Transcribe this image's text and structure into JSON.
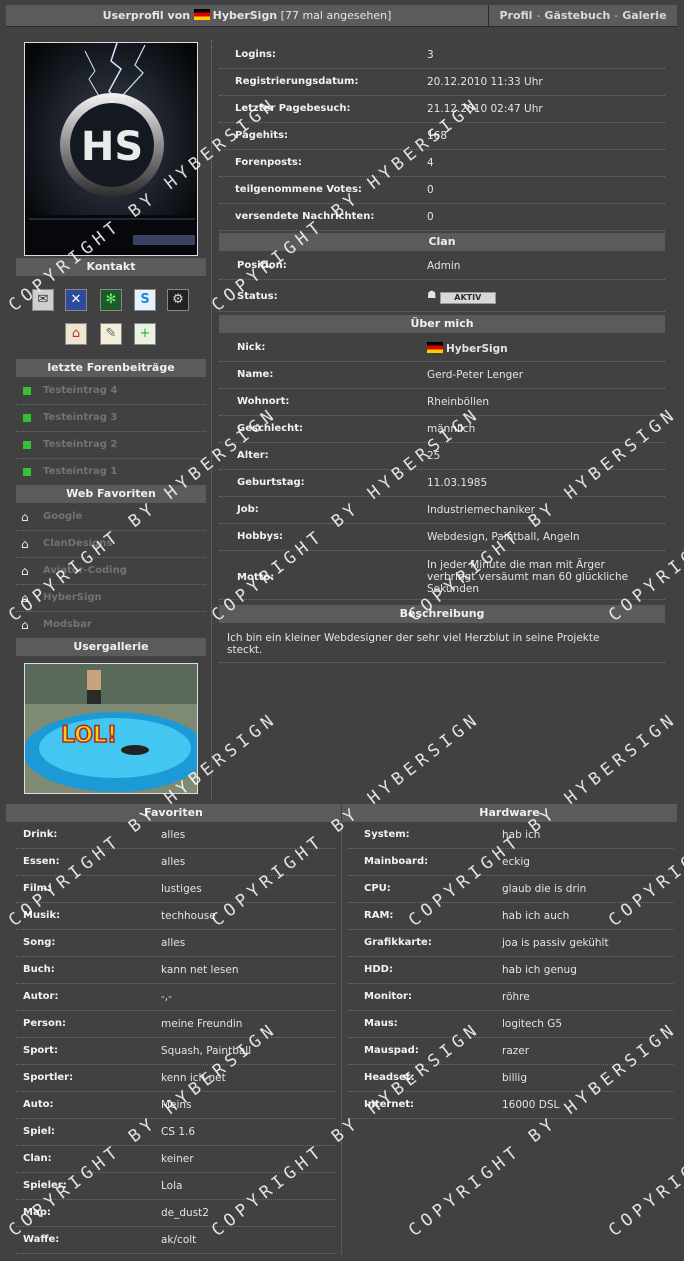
{
  "header": {
    "title_prefix": "Userprofil von",
    "username": "HyberSign",
    "views": "[77 mal angesehen]",
    "links": [
      "Profil",
      "Gästebuch",
      "Galerie"
    ]
  },
  "avatar": {
    "letters": "HS"
  },
  "kontakt": {
    "title": "Kontakt",
    "icons": [
      "mail-icon",
      "xfire-icon",
      "icq-icon",
      "skype-icon",
      "steam-icon",
      "homepage-icon",
      "guestbook-icon",
      "add-friend-icon"
    ]
  },
  "forum": {
    "title": "letzte Forenbeiträge",
    "items": [
      "Testeintrag 4",
      "Testeintrag 3",
      "Testeintrag 2",
      "Testeintrag 1"
    ]
  },
  "favorites_web": {
    "title": "Web Favoriten",
    "items": [
      "Google",
      "ClanDesigns",
      "Aviator-Coding",
      "HyberSign",
      "Modsbar"
    ]
  },
  "gallery": {
    "title": "Usergallerie",
    "caption": "LOL!"
  },
  "stats": [
    {
      "label": "Logins:",
      "value": "3"
    },
    {
      "label": "Registrierungsdatum:",
      "value": "20.12.2010 11:33 Uhr"
    },
    {
      "label": "Letzter Pagebesuch:",
      "value": "21.12.2010 02:47 Uhr"
    },
    {
      "label": "Pagehits:",
      "value": "168"
    },
    {
      "label": "Forenposts:",
      "value": "4"
    },
    {
      "label": "teilgenommene Votes:",
      "value": "0"
    },
    {
      "label": "versendete Nachrichten:",
      "value": "0"
    }
  ],
  "clan": {
    "title": "Clan",
    "position_label": "Position:",
    "position_value": "Admin",
    "status_label": "Status:",
    "status_value": "AKTIV"
  },
  "about": {
    "title": "Über mich",
    "rows": [
      {
        "label": "Nick:",
        "value": "HyberSign"
      },
      {
        "label": "Name:",
        "value": "Gerd-Peter Lenger"
      },
      {
        "label": "Wohnort:",
        "value": "Rheinböllen"
      },
      {
        "label": "Geschlecht:",
        "value": "männlich"
      },
      {
        "label": "Alter:",
        "value": "25"
      },
      {
        "label": "Geburtstag:",
        "value": "11.03.1985"
      },
      {
        "label": "Job:",
        "value": "Industriemechaniker"
      },
      {
        "label": "Hobbys:",
        "value": "Webdesign, Paintball, Angeln"
      }
    ],
    "motto_label": "Motto:",
    "motto_lines": [
      "In jeder Minute die man mit Ärger",
      "verbringt versäumt man 60 glückliche",
      "Sekunden"
    ]
  },
  "description": {
    "title": "Beschreibung",
    "lines": [
      "Ich bin ein kleiner Webdesigner der sehr viel Herzblut in seine Projekte",
      "steckt."
    ]
  },
  "favoriten": {
    "title": "Favoriten",
    "rows": [
      {
        "label": "Drink:",
        "value": "alles"
      },
      {
        "label": "Essen:",
        "value": "alles"
      },
      {
        "label": "Film:",
        "value": "lustiges"
      },
      {
        "label": "Musik:",
        "value": "techhouse"
      },
      {
        "label": "Song:",
        "value": "alles"
      },
      {
        "label": "Buch:",
        "value": "kann net lesen"
      },
      {
        "label": "Autor:",
        "value": "-,-"
      },
      {
        "label": "Person:",
        "value": "meine Freundin"
      },
      {
        "label": "Sport:",
        "value": "Squash, Paintball"
      },
      {
        "label": "Sportler:",
        "value": "kenn ich net"
      },
      {
        "label": "Auto:",
        "value": "Meins"
      },
      {
        "label": "Spiel:",
        "value": "CS 1.6"
      },
      {
        "label": "Clan:",
        "value": "keiner"
      },
      {
        "label": "Spieler:",
        "value": "Lola"
      },
      {
        "label": "Map:",
        "value": "de_dust2"
      },
      {
        "label": "Waffe:",
        "value": "ak/colt"
      }
    ]
  },
  "hardware": {
    "title": "Hardware",
    "rows": [
      {
        "label": "System:",
        "value": "hab ich"
      },
      {
        "label": "Mainboard:",
        "value": "eckig"
      },
      {
        "label": "CPU:",
        "value": "glaub die is drin"
      },
      {
        "label": "RAM:",
        "value": "hab ich auch"
      },
      {
        "label": "Grafikkarte:",
        "value": "joa is passiv gekühlt"
      },
      {
        "label": "HDD:",
        "value": "hab ich genug"
      },
      {
        "label": "Monitor:",
        "value": "röhre"
      },
      {
        "label": "Maus:",
        "value": "logitech G5"
      },
      {
        "label": "Mauspad:",
        "value": "razer"
      },
      {
        "label": "Headset:",
        "value": "billig"
      },
      {
        "label": "Internet:",
        "value": "16000 DSL"
      }
    ]
  },
  "watermark": "COPYRIGHT BY HYBERSIGN"
}
